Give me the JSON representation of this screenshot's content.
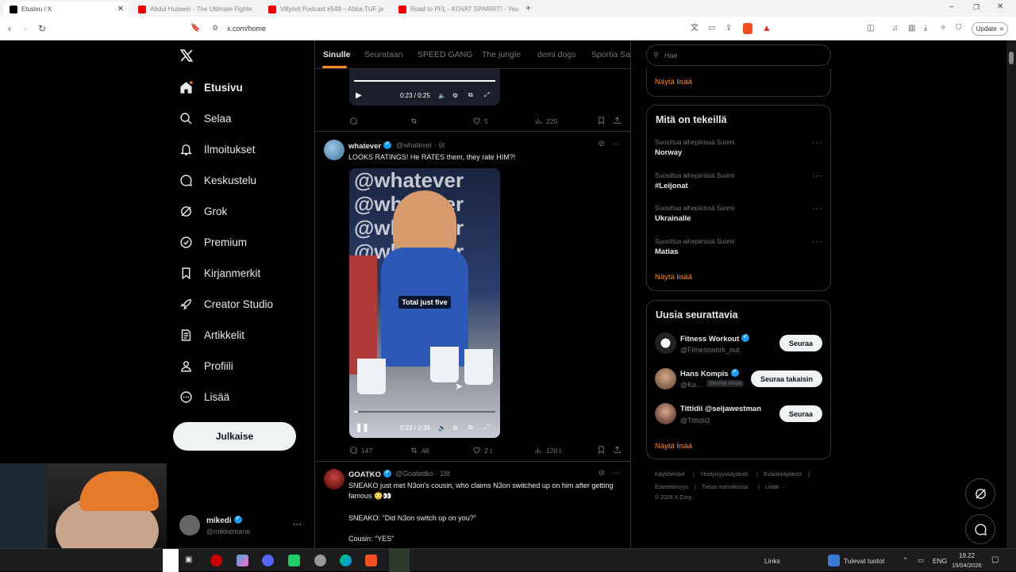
{
  "browser": {
    "tabs": [
      {
        "title": "Etusivu / X",
        "active": true
      },
      {
        "title": "Abdul Hussein - The Ultimate Fighte",
        "active": false
      },
      {
        "title": "Viilyörit Podcast #549 – Abba TUF ja",
        "active": false
      },
      {
        "title": "Road to PFL - KOVAT SPARRIT! - You",
        "active": false
      }
    ],
    "new_tab": "+",
    "url": "x.com/home",
    "update_label": "Update"
  },
  "nav": {
    "logo": "X",
    "items": [
      {
        "label": "Etusivu",
        "icon": "home-icon"
      },
      {
        "label": "Selaa",
        "icon": "search-icon"
      },
      {
        "label": "Ilmoitukset",
        "icon": "bell-icon"
      },
      {
        "label": "Keskustelu",
        "icon": "chat-icon"
      },
      {
        "label": "Grok",
        "icon": "grok-icon"
      },
      {
        "label": "Premium",
        "icon": "premium-icon"
      },
      {
        "label": "Kirjanmerkit",
        "icon": "bookmark-icon"
      },
      {
        "label": "Creator Studio",
        "icon": "rocket-icon"
      },
      {
        "label": "Artikkelit",
        "icon": "article-icon"
      },
      {
        "label": "Profiili",
        "icon": "profile-icon"
      },
      {
        "label": "Lisää",
        "icon": "more-icon"
      }
    ],
    "post_button": "Julkaise",
    "account": {
      "name": "mikedi",
      "handle": "@mikkemane",
      "menu": "···"
    }
  },
  "feed": {
    "tabs": [
      "Sinulle",
      "Seurataan",
      "SPEED GANG",
      "The jungle",
      "demi dogs",
      "Sportia Sa"
    ],
    "top_post": {
      "video_time": "0:23 / 0:25",
      "actions": {
        "reply": "",
        "repost": "",
        "like": "5",
        "views": "225"
      }
    },
    "post1": {
      "name": "whatever",
      "handle": "@whatever",
      "time": "6t",
      "text": "LOOKS RATINGS! He RATES them, they rate HIM?!",
      "caption": "Total just five",
      "video_time": "0:23 / 2:39",
      "actions": {
        "reply": "147",
        "repost": "48",
        "like": "2 t.",
        "views": "120 t."
      }
    },
    "post2": {
      "name": "GOATKO",
      "handle": "@Goatedko",
      "time": "18t",
      "text1": "SNEAKO just met N3on's cousin, who claims N3on switched up on him after getting famous 😳👀",
      "text2": "SNEAKO: \"Did N3on switch up on you?\"",
      "text3": "Cousin: \"YES\""
    }
  },
  "sidebar": {
    "search_placeholder": "Hae",
    "show_more": "Näytä lisää",
    "trends_title": "Mitä on tekeillä",
    "trends": [
      {
        "context": "Suosittua aihepiirissä Suomi",
        "name": "Norway"
      },
      {
        "context": "Suosittua aihepiirissä Suomi",
        "name": "#Leijonat"
      },
      {
        "context": "Suosittua aihepiirissä Suomi",
        "name": "Ukrainalle"
      },
      {
        "context": "Suosittua aihepiirissä Suomi",
        "name": "Matias"
      }
    ],
    "who_title": "Uusia seurattavia",
    "who": [
      {
        "name": "Fitness Workout",
        "handle": "@Fitnesswork_out",
        "button": "Seuraa",
        "badge": ""
      },
      {
        "name": "Hans Kompis",
        "handle": "@Ko...",
        "button": "Seuraa takaisin",
        "badge": "Seuraa sinua"
      },
      {
        "name": "Tittidii @seijawestman",
        "handle": "@Tittidii3",
        "button": "Seuraa",
        "badge": ""
      }
    ],
    "footer": [
      "Käyttöehdot",
      "|",
      "Yksityisyyskäytäntö",
      "|",
      "Evästekäytäntö",
      "|",
      "Esteettömyys",
      "|",
      "Tietoa mainoksista",
      "|",
      "Lisää ···",
      "© 2026 X Corp."
    ]
  },
  "taskbar": {
    "links": "Links",
    "weather": "Tulevat tuotot",
    "lang": "ENG",
    "time": "19.22",
    "date": "15/04/2026"
  },
  "colors": {
    "accent": "#f4862c",
    "verified": "#1d9bf0",
    "bg": "#000000"
  }
}
